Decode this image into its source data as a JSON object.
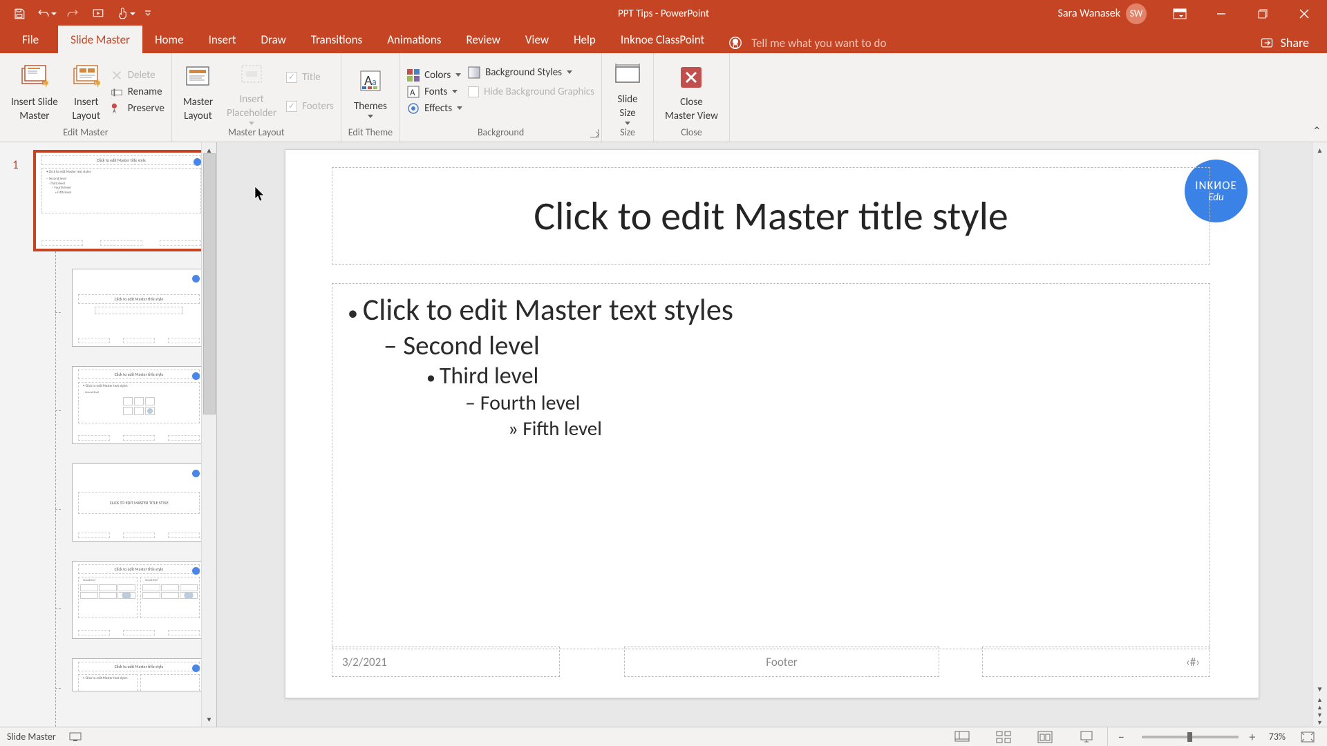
{
  "title_bar": {
    "doc_title": "PPT Tips  -  PowerPoint",
    "user_name": "Sara Wanasek",
    "user_initials": "SW"
  },
  "ribbon": {
    "tabs": {
      "file": "File",
      "slide_master": "Slide Master",
      "home": "Home",
      "insert": "Insert",
      "draw": "Draw",
      "transitions": "Transitions",
      "animations": "Animations",
      "review": "Review",
      "view": "View",
      "help": "Help",
      "inknoe": "Inknoe ClassPoint"
    },
    "tellme": "Tell me what you want to do",
    "share": "Share"
  },
  "ribbon_groups": {
    "edit_master": {
      "label": "Edit Master",
      "insert_slide_master": "Insert Slide\nMaster",
      "insert_layout": "Insert\nLayout",
      "delete": "Delete",
      "rename": "Rename",
      "preserve": "Preserve"
    },
    "master_layout": {
      "label": "Master Layout",
      "master_layout_btn": "Master\nLayout",
      "insert_placeholder": "Insert\nPlaceholder",
      "title_chk": "Title",
      "footers_chk": "Footers"
    },
    "edit_theme": {
      "label": "Edit Theme",
      "themes": "Themes"
    },
    "background": {
      "label": "Background",
      "colors": "Colors",
      "fonts": "Fonts",
      "effects": "Effects",
      "bg_styles": "Background Styles",
      "hide_bg": "Hide Background Graphics"
    },
    "size": {
      "label": "Size",
      "slide_size": "Slide\nSize"
    },
    "close": {
      "label": "Close",
      "close_mv": "Close\nMaster View"
    }
  },
  "thumbs": {
    "master_number": "1"
  },
  "slide": {
    "title_ph": "Click to edit Master title style",
    "body": {
      "l1": "Click to edit Master text styles",
      "l2": "Second level",
      "l3": "Third level",
      "l4": "Fourth level",
      "l5": "Fifth level"
    },
    "date_ph": "3/2/2021",
    "footer_ph": "Footer",
    "slidenum_ph": "‹#›",
    "logo": {
      "line1": "INKИOE",
      "line2": "Edu"
    }
  },
  "status": {
    "mode": "Slide Master",
    "zoom": "73%"
  },
  "mini": {
    "t1": "Click to edit Master title style",
    "t2": "CLICK TO EDIT MASTER TITLE STYLE",
    "body": "– Second level\n   · Third level\n       – Fourth level\n           » Fifth level",
    "body_hdr": "• Click to edit Master text styles"
  }
}
